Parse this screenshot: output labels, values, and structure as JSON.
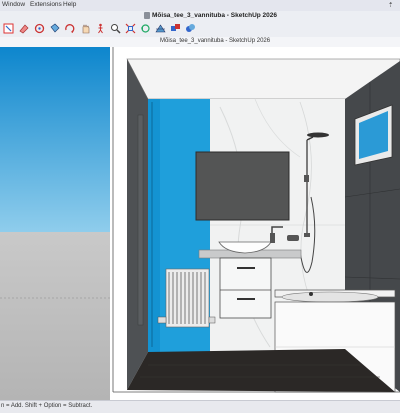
{
  "menu": {
    "items": [
      "Window",
      "Extensions",
      "Help"
    ],
    "right_glyph": "⇡"
  },
  "window": {
    "title": "Mõisa_tee_3_vannituba - SketchUp 2026"
  },
  "document": {
    "tab_title": "Mõisa_tee_3_vannituba - SketchUp 2026"
  },
  "toolbar": {
    "icons": [
      "select-icon",
      "eraser-icon",
      "tape-measure-icon",
      "paint-bucket-icon",
      "orbit-icon",
      "pan-icon",
      "walk-icon",
      "zoom-icon",
      "zoom-extents-icon",
      "previous-view-icon",
      "warehouse-icon",
      "extension-warehouse-icon",
      "layout-icon"
    ]
  },
  "status": {
    "hint": "n = Add. Shift + Option = Subtract."
  },
  "colors": {
    "accent_blue": "#1f9fdb",
    "sky": "#2aa3dc",
    "wall_dark": "#4a4d50",
    "floor": "#2b2826"
  }
}
